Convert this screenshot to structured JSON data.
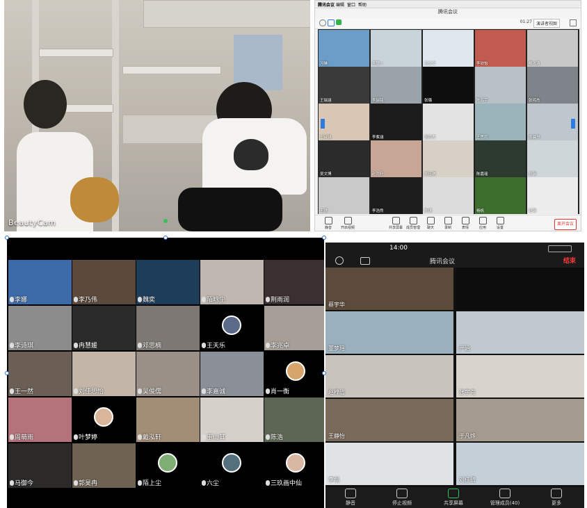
{
  "photo": {
    "watermark": "BeautyCam"
  },
  "top_right": {
    "menu": [
      "腾讯会议",
      "编辑",
      "窗口",
      "帮助"
    ],
    "window_title": "腾讯会议",
    "clock": "01:27",
    "layout_label": "演讲者视图",
    "tiles": [
      {
        "name": "冯琳",
        "bg": "#6c9cc8"
      },
      {
        "name": "李慧一",
        "bg": "#c9d3da"
      },
      {
        "name": "王立文",
        "bg": "#dfe8ee"
      },
      {
        "name": "李欣怡",
        "bg": "#c25b4f"
      },
      {
        "name": "杨冰清",
        "bg": "#c8c8c8"
      },
      {
        "name": "王瑞涵",
        "bg": "#3a3a3a"
      },
      {
        "name": "李瑞铭",
        "bg": "#9aa3a9"
      },
      {
        "name": "张璐",
        "bg": "#0e0e0e"
      },
      {
        "name": "陈鸿宇",
        "bg": "#b7c1c7"
      },
      {
        "name": "张鸿杰",
        "bg": "#7e8489"
      },
      {
        "name": "王诗涵",
        "bg": "#d7c7b4"
      },
      {
        "name": "李紫涵",
        "bg": "#1b1b1b"
      },
      {
        "name": "张雨杰",
        "bg": "#e3e3e3"
      },
      {
        "name": "王思雨",
        "bg": "#9ab4ba"
      },
      {
        "name": "廖晨书",
        "bg": "#bfc6cc"
      },
      {
        "name": "吴文博",
        "bg": "#2b2b2b"
      },
      {
        "name": "赵雨轩",
        "bg": "#c7a698"
      },
      {
        "name": "刘佳琪",
        "bg": "#d6d0c7"
      },
      {
        "name": "陈嘉瑶",
        "bg": "#2c3a2f"
      },
      {
        "name": "张瑞",
        "bg": "#cfd6da"
      },
      {
        "name": "王琪",
        "bg": "#c9c9c9"
      },
      {
        "name": "李浩然",
        "bg": "#1d1d1d"
      },
      {
        "name": "陈琪",
        "bg": "#dcdcdc"
      },
      {
        "name": "杨帆",
        "bg": "#3e6e2e"
      },
      {
        "name": "赵瑞",
        "bg": "#ececec"
      }
    ],
    "toolbar": [
      "静音",
      "开启视频",
      "共享屏幕",
      "成员管理",
      "聊天",
      "录制",
      "表情",
      "应用",
      "设置"
    ],
    "end_button": "离开会议"
  },
  "bottom_left": {
    "tiles": [
      {
        "name": "李娜",
        "bg": "#3d6aa8",
        "avatar": ""
      },
      {
        "name": "李乃伟",
        "bg": "#5b4a3c",
        "avatar": ""
      },
      {
        "name": "魏奕",
        "bg": "#1e3d58",
        "avatar": ""
      },
      {
        "name": "陌晗尘",
        "bg": "#bfb7b0",
        "avatar": ""
      },
      {
        "name": "荆雨润",
        "bg": "#3b2f2f",
        "avatar": ""
      },
      {
        "name": "李诗琪",
        "bg": "#8c8c8c",
        "avatar": ""
      },
      {
        "name": "冉慧媛",
        "bg": "#2a2a2a",
        "avatar": ""
      },
      {
        "name": "邓思楠",
        "bg": "#7d7873",
        "avatar": ""
      },
      {
        "name": "王天乐",
        "bg": "#000000",
        "avatar": "#5c6a8a"
      },
      {
        "name": "李兆卓",
        "bg": "#a79f97",
        "avatar": ""
      },
      {
        "name": "王一然",
        "bg": "#6b5f55",
        "avatar": ""
      },
      {
        "name": "刘佳思怡",
        "bg": "#c3b6a8",
        "avatar": ""
      },
      {
        "name": "吴俊儒",
        "bg": "#9a9088",
        "avatar": ""
      },
      {
        "name": "李嘉诚",
        "bg": "#8b8f97",
        "avatar": ""
      },
      {
        "name": "肖一衡",
        "bg": "#000000",
        "avatar": "#d7a46a"
      },
      {
        "name": "周萌雨",
        "bg": "#b4727a",
        "avatar": ""
      },
      {
        "name": "叶梦婷",
        "bg": "#000000",
        "avatar": "#d9b59b"
      },
      {
        "name": "戴泓轩",
        "bg": "#a28e76",
        "avatar": ""
      },
      {
        "name": "玉山其",
        "bg": "#d5d0ca",
        "avatar": ""
      },
      {
        "name": "陈浩",
        "bg": "#5d6654",
        "avatar": ""
      },
      {
        "name": "马御今",
        "bg": "#2b2a29",
        "avatar": ""
      },
      {
        "name": "郭昊冉",
        "bg": "#6e6253",
        "avatar": ""
      },
      {
        "name": "陌上尘",
        "bg": "#000000",
        "avatar": "#7fae74"
      },
      {
        "name": "六尘",
        "bg": "#000000",
        "avatar": "#55707d"
      },
      {
        "name": "三玖画中仙",
        "bg": "#000000",
        "avatar": "#d8b8a2"
      }
    ]
  },
  "bottom_right": {
    "status_time": "14:00",
    "app_title": "腾讯会议",
    "end_label": "结束",
    "tiles": [
      {
        "name": "蔡宇华",
        "bg": "#5c4a3a"
      },
      {
        "name": "",
        "bg": "#0c0c0c"
      },
      {
        "name": "董梦瑶",
        "bg": "#9ab0bd"
      },
      {
        "name": "严涵",
        "bg": "#bfc9cf"
      },
      {
        "name": "赵梓洁",
        "bg": "#c8c3bd"
      },
      {
        "name": "张宇舟",
        "bg": "#d8d3cd"
      },
      {
        "name": "王静怡",
        "bg": "#7a6a5a"
      },
      {
        "name": "于凡烨",
        "bg": "#a49a8e"
      },
      {
        "name": "李翔",
        "bg": "#dfe3e6"
      },
      {
        "name": "刘佳琦",
        "bg": "#c5cfd8"
      }
    ],
    "bottom": [
      "静音",
      "停止视频",
      "共享屏幕",
      "管理成员(40)",
      "更多"
    ]
  }
}
